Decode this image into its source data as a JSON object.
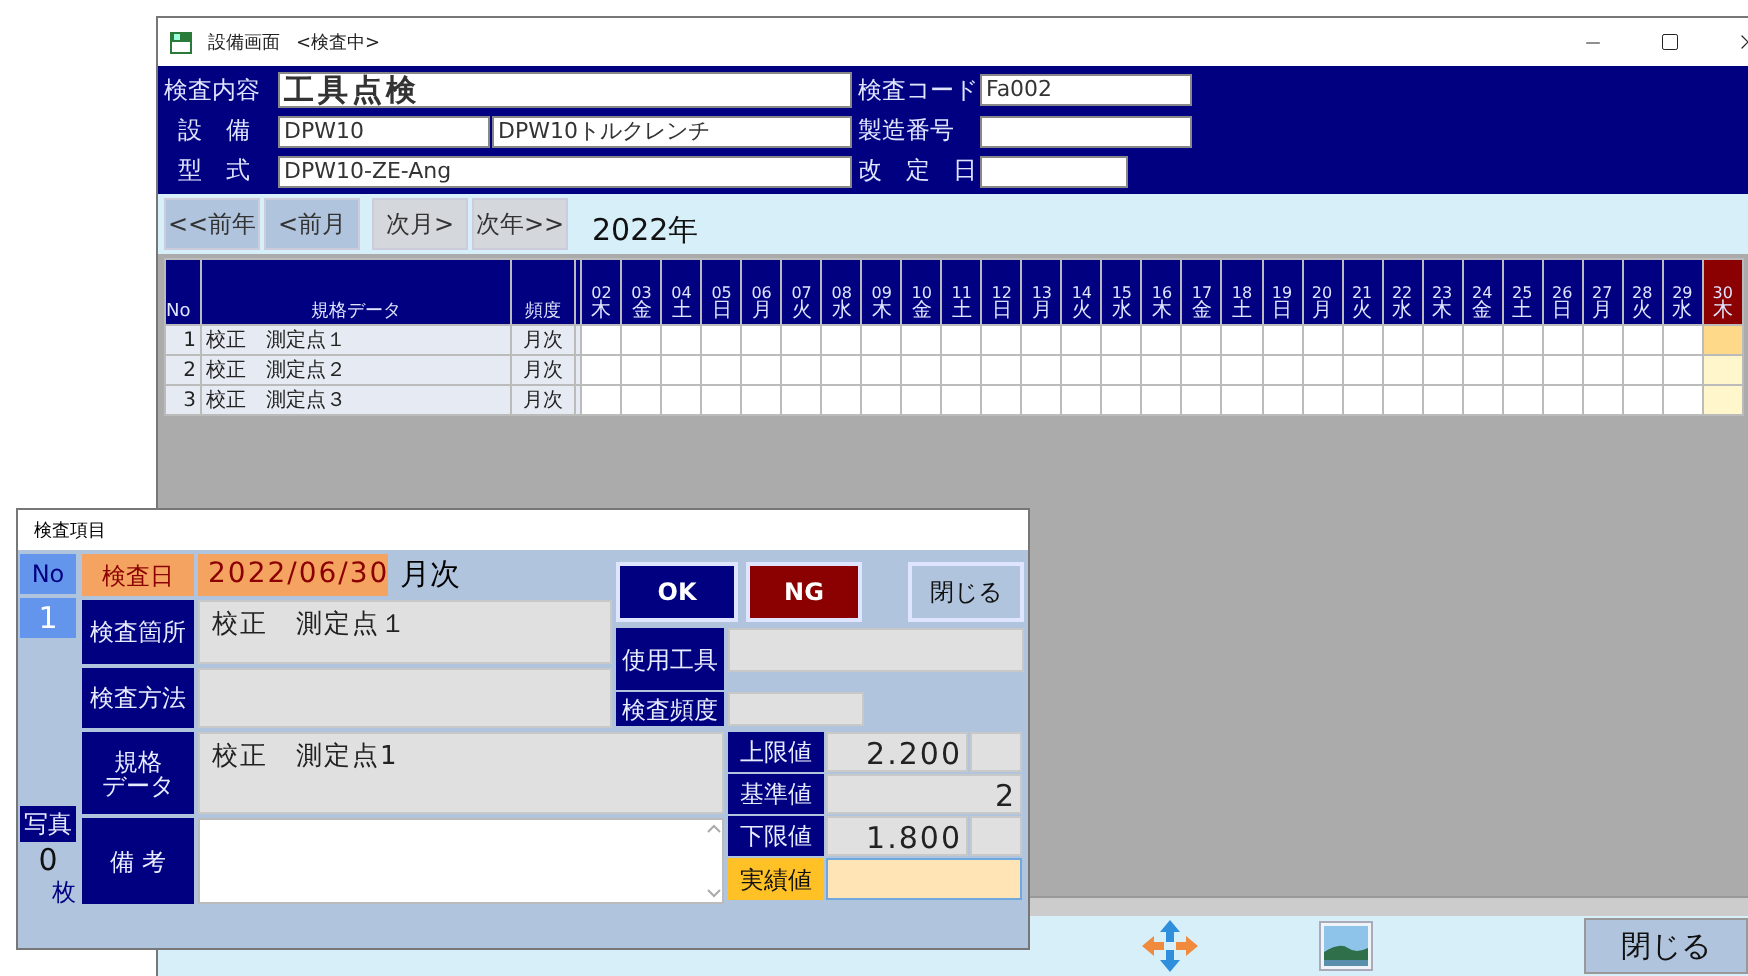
{
  "window": {
    "title": "設備画面",
    "status": "<検査中>"
  },
  "header": {
    "inspection": {
      "label": "検査内容",
      "value": "工具点検"
    },
    "equipment": {
      "label": "設 備",
      "code": "DPW10",
      "name": "DPW10トルクレンチ"
    },
    "model": {
      "label": "型 式",
      "value": "DPW10-ZE-Ang"
    },
    "code": {
      "label": "検査コード",
      "value": "Fa002"
    },
    "serial": {
      "label": "製造番号"
    },
    "revised": {
      "label": "改 定 日"
    }
  },
  "nav": {
    "buttons": [
      {
        "label": "<<前年",
        "kind": "back"
      },
      {
        "label": "<前月",
        "kind": "back"
      },
      {
        "label": "次月>",
        "kind": "forward"
      },
      {
        "label": "次年>>",
        "kind": "forward"
      }
    ],
    "year": "2022年"
  },
  "grid": {
    "columns": {
      "no": "No",
      "spec": "規格データ",
      "freq": "頻度"
    },
    "days": [
      {
        "day": "02",
        "weekday": "木",
        "selected": false
      },
      {
        "day": "03",
        "weekday": "金",
        "selected": false
      },
      {
        "day": "04",
        "weekday": "土",
        "selected": false
      },
      {
        "day": "05",
        "weekday": "日",
        "selected": false
      },
      {
        "day": "06",
        "weekday": "月",
        "selected": false
      },
      {
        "day": "07",
        "weekday": "火",
        "selected": false
      },
      {
        "day": "08",
        "weekday": "水",
        "selected": false
      },
      {
        "day": "09",
        "weekday": "木",
        "selected": false
      },
      {
        "day": "10",
        "weekday": "金",
        "selected": false
      },
      {
        "day": "11",
        "weekday": "土",
        "selected": false
      },
      {
        "day": "12",
        "weekday": "日",
        "selected": false
      },
      {
        "day": "13",
        "weekday": "月",
        "selected": false
      },
      {
        "day": "14",
        "weekday": "火",
        "selected": false
      },
      {
        "day": "15",
        "weekday": "水",
        "selected": false
      },
      {
        "day": "16",
        "weekday": "木",
        "selected": false
      },
      {
        "day": "17",
        "weekday": "金",
        "selected": false
      },
      {
        "day": "18",
        "weekday": "土",
        "selected": false
      },
      {
        "day": "19",
        "weekday": "日",
        "selected": false
      },
      {
        "day": "20",
        "weekday": "月",
        "selected": false
      },
      {
        "day": "21",
        "weekday": "火",
        "selected": false
      },
      {
        "day": "22",
        "weekday": "水",
        "selected": false
      },
      {
        "day": "23",
        "weekday": "木",
        "selected": false
      },
      {
        "day": "24",
        "weekday": "金",
        "selected": false
      },
      {
        "day": "25",
        "weekday": "土",
        "selected": false
      },
      {
        "day": "26",
        "weekday": "日",
        "selected": false
      },
      {
        "day": "27",
        "weekday": "月",
        "selected": false
      },
      {
        "day": "28",
        "weekday": "火",
        "selected": false
      },
      {
        "day": "29",
        "weekday": "水",
        "selected": false
      },
      {
        "day": "30",
        "weekday": "木",
        "selected": true
      }
    ],
    "rows": [
      {
        "no": "1",
        "spec": "校正　測定点１",
        "freq": "月次",
        "selected": true
      },
      {
        "no": "2",
        "spec": "校正　測定点２",
        "freq": "月次",
        "selected": false
      },
      {
        "no": "3",
        "spec": "校正　測定点３",
        "freq": "月次",
        "selected": false
      }
    ]
  },
  "dialog": {
    "title": "検査項目",
    "no_label": "No",
    "no": "1",
    "photo_label": "写真",
    "photo_count": "0",
    "photo_unit": "枚",
    "date_label": "検査日",
    "date": "2022/06/30",
    "frequency": "月次",
    "buttons": [
      {
        "label": "OK",
        "kind": "ok"
      },
      {
        "label": "NG",
        "kind": "ng"
      },
      {
        "label": "閉じる",
        "kind": "close"
      }
    ],
    "location": {
      "label": "検査箇所",
      "value": "校正　測定点１"
    },
    "method": {
      "label": "検査方法"
    },
    "tool": {
      "label": "使用工具"
    },
    "interval": {
      "label": "検査頻度"
    },
    "spec": {
      "label_lines": [
        "規格",
        "データ"
      ],
      "value": "校正　測定点1"
    },
    "remarks": {
      "label": "備 考"
    },
    "limits": [
      {
        "label": "上限値",
        "value": "2.200",
        "kind": "limit"
      },
      {
        "label": "基準値",
        "value": "2",
        "kind": "base"
      },
      {
        "label": "下限値",
        "value": "1.800",
        "kind": "limit"
      }
    ],
    "result": {
      "label": "実績値"
    }
  },
  "toolbar": {
    "close": "閉じる"
  }
}
